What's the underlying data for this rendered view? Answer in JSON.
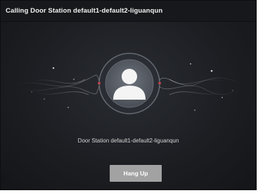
{
  "dialog": {
    "title": "Calling Door Station default1-default2-liguanqun",
    "caller_name": "Door Station default1-default2-liguanqun",
    "hangup_label": "Hang Up"
  },
  "icons": {
    "avatar": "user-silhouette-icon"
  },
  "colors": {
    "background": "#1c1e22",
    "titlebar": "#17181b",
    "button": "#a2a2a2",
    "ring_accent": "#c0404a"
  }
}
